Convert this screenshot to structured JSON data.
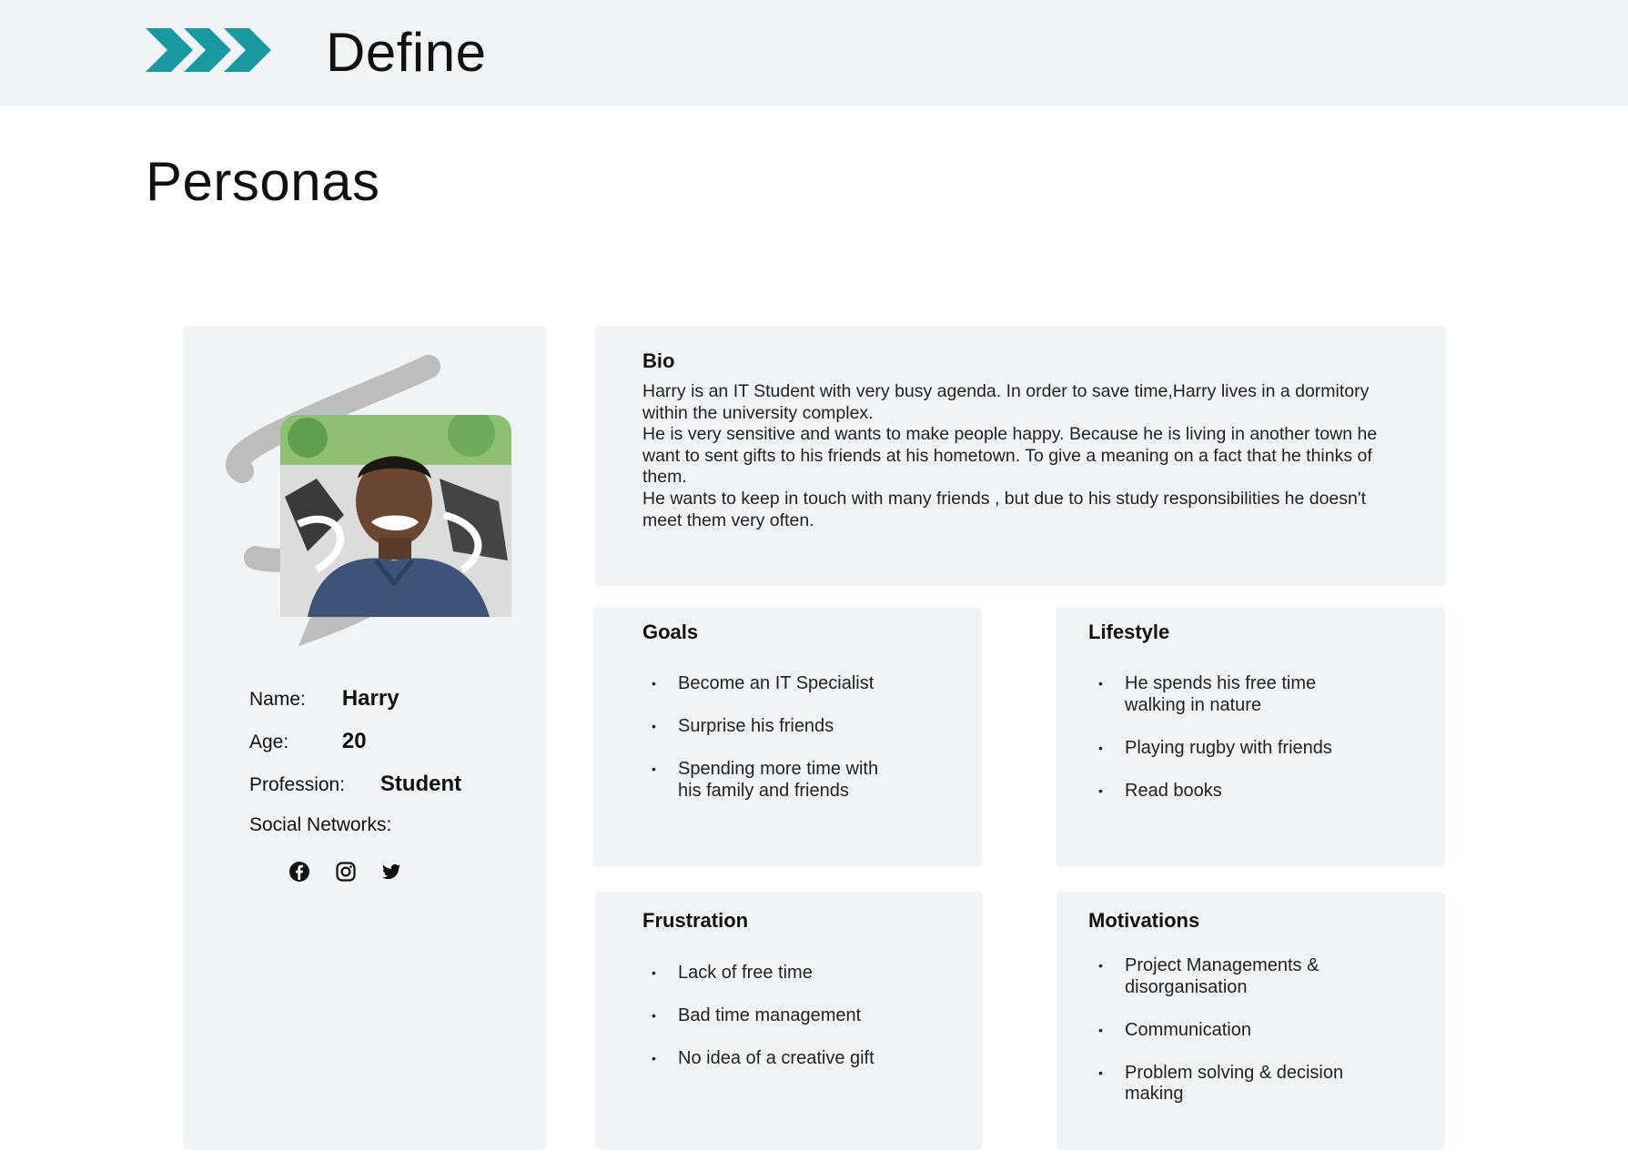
{
  "header": {
    "title": "Define"
  },
  "page": {
    "title": "Personas"
  },
  "profile": {
    "name_label": "Name:",
    "name": "Harry",
    "age_label": "Age:",
    "age": "20",
    "profession_label": "Profession:",
    "profession": "Student",
    "social_label": "Social Networks:",
    "socials": [
      "facebook-icon",
      "instagram-icon",
      "twitter-icon"
    ]
  },
  "bio": {
    "title": "Bio",
    "paragraphs": [
      "Harry is an IT Student with very busy agenda. In order to save time,Harry lives in a dormitory within the university complex.",
      "He is very sensitive and wants to make people happy. Because he is living in another town he want to sent gifts to his friends at his hometown. To give a meaning on a fact that he thinks of them.",
      "He wants to keep in touch with many friends , but due to his study responsibilities he doesn't meet them very often."
    ]
  },
  "goals": {
    "title": "Goals",
    "items": [
      "Become an IT Specialist",
      "Surprise his friends",
      "Spending more time with his family and friends"
    ]
  },
  "lifestyle": {
    "title": "Lifestyle",
    "items": [
      "He spends his free time walking in nature",
      "Playing rugby with friends",
      "Read books"
    ]
  },
  "frustration": {
    "title": "Frustration",
    "items": [
      "Lack of free time",
      "Bad time management",
      "No idea of a creative gift"
    ]
  },
  "motivations": {
    "title": "Motivations",
    "items": [
      "Project Managements & disorganisation",
      "Communication",
      "Problem solving & decision making"
    ]
  },
  "colors": {
    "accent": "#1a9aa0",
    "card": "#f1f4f7",
    "header": "#f1f4f7"
  }
}
